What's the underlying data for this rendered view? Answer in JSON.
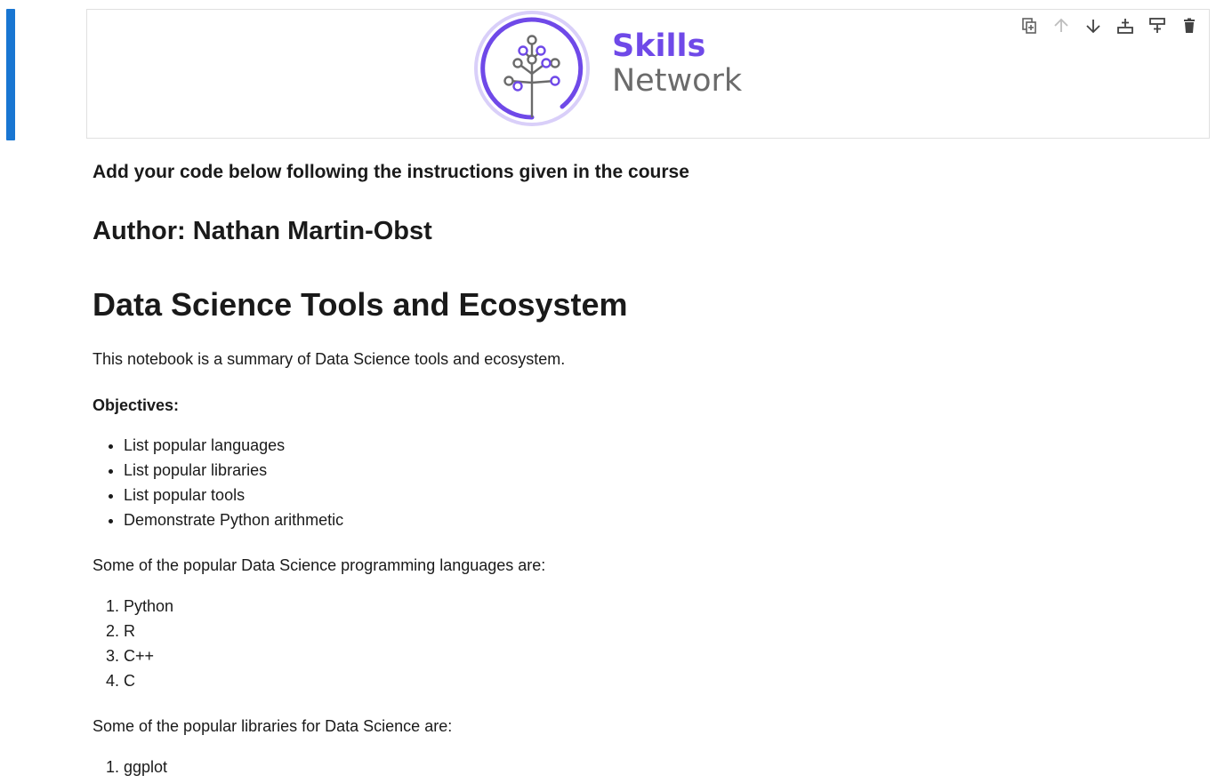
{
  "header": {
    "brand_line1": "Skills",
    "brand_line2": "Network",
    "accent_color": "#6f49e8",
    "toolbar": [
      {
        "name": "duplicate-cell-icon"
      },
      {
        "name": "move-up-icon"
      },
      {
        "name": "move-down-icon"
      },
      {
        "name": "insert-above-icon"
      },
      {
        "name": "insert-below-icon"
      },
      {
        "name": "delete-cell-icon"
      }
    ]
  },
  "notebook": {
    "instructions": "Add your code below following the instructions given in the course",
    "author": "Author: Nathan Martin-Obst",
    "title": "Data Science Tools and Ecosystem",
    "summary": "This notebook is a summary of Data Science tools and ecosystem.",
    "objectives_label": "Objectives:",
    "objectives": [
      "List popular languages",
      "List popular libraries",
      "List popular tools",
      "Demonstrate Python arithmetic"
    ],
    "languages_intro": "Some of the popular Data Science programming languages are:",
    "languages": [
      "Python",
      "R",
      "C++",
      "C"
    ],
    "libraries_intro": "Some of the popular libraries for Data Science are:",
    "libraries": [
      "ggplot"
    ]
  }
}
